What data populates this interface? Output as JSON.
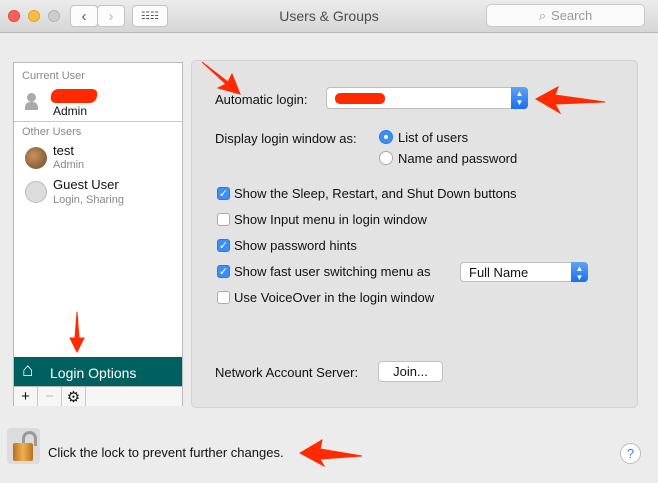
{
  "window": {
    "title": "Users & Groups",
    "search_placeholder": "Search"
  },
  "sidebar": {
    "current_user_header": "Current User",
    "current_user_role": "Admin",
    "other_users_header": "Other Users",
    "users": [
      {
        "name": "test",
        "role": "Admin"
      },
      {
        "name": "Guest User",
        "role": "Login, Sharing"
      }
    ],
    "login_options_label": "Login Options",
    "add_label": "+",
    "remove_label": "−"
  },
  "panel": {
    "automatic_login_label": "Automatic login:",
    "display_login_label": "Display login window as:",
    "radio_options": [
      {
        "label": "List of users",
        "selected": true
      },
      {
        "label": "Name and password",
        "selected": false
      }
    ],
    "checkboxes": [
      {
        "label": "Show the Sleep, Restart, and Shut Down buttons",
        "checked": true
      },
      {
        "label": "Show Input menu in login window",
        "checked": false
      },
      {
        "label": "Show password hints",
        "checked": true
      },
      {
        "label": "Show fast user switching menu as",
        "checked": true
      },
      {
        "label": "Use VoiceOver in the login window",
        "checked": false
      }
    ],
    "fast_user_switching_value": "Full Name",
    "network_account_label": "Network Account Server:",
    "join_label": "Join..."
  },
  "footer": {
    "lock_text": "Click the lock to prevent further changes.",
    "help_label": "?"
  },
  "colors": {
    "login_options_bg": "#005f5f",
    "accent": "#3d8ff5",
    "annotation": "#ff2a00"
  }
}
